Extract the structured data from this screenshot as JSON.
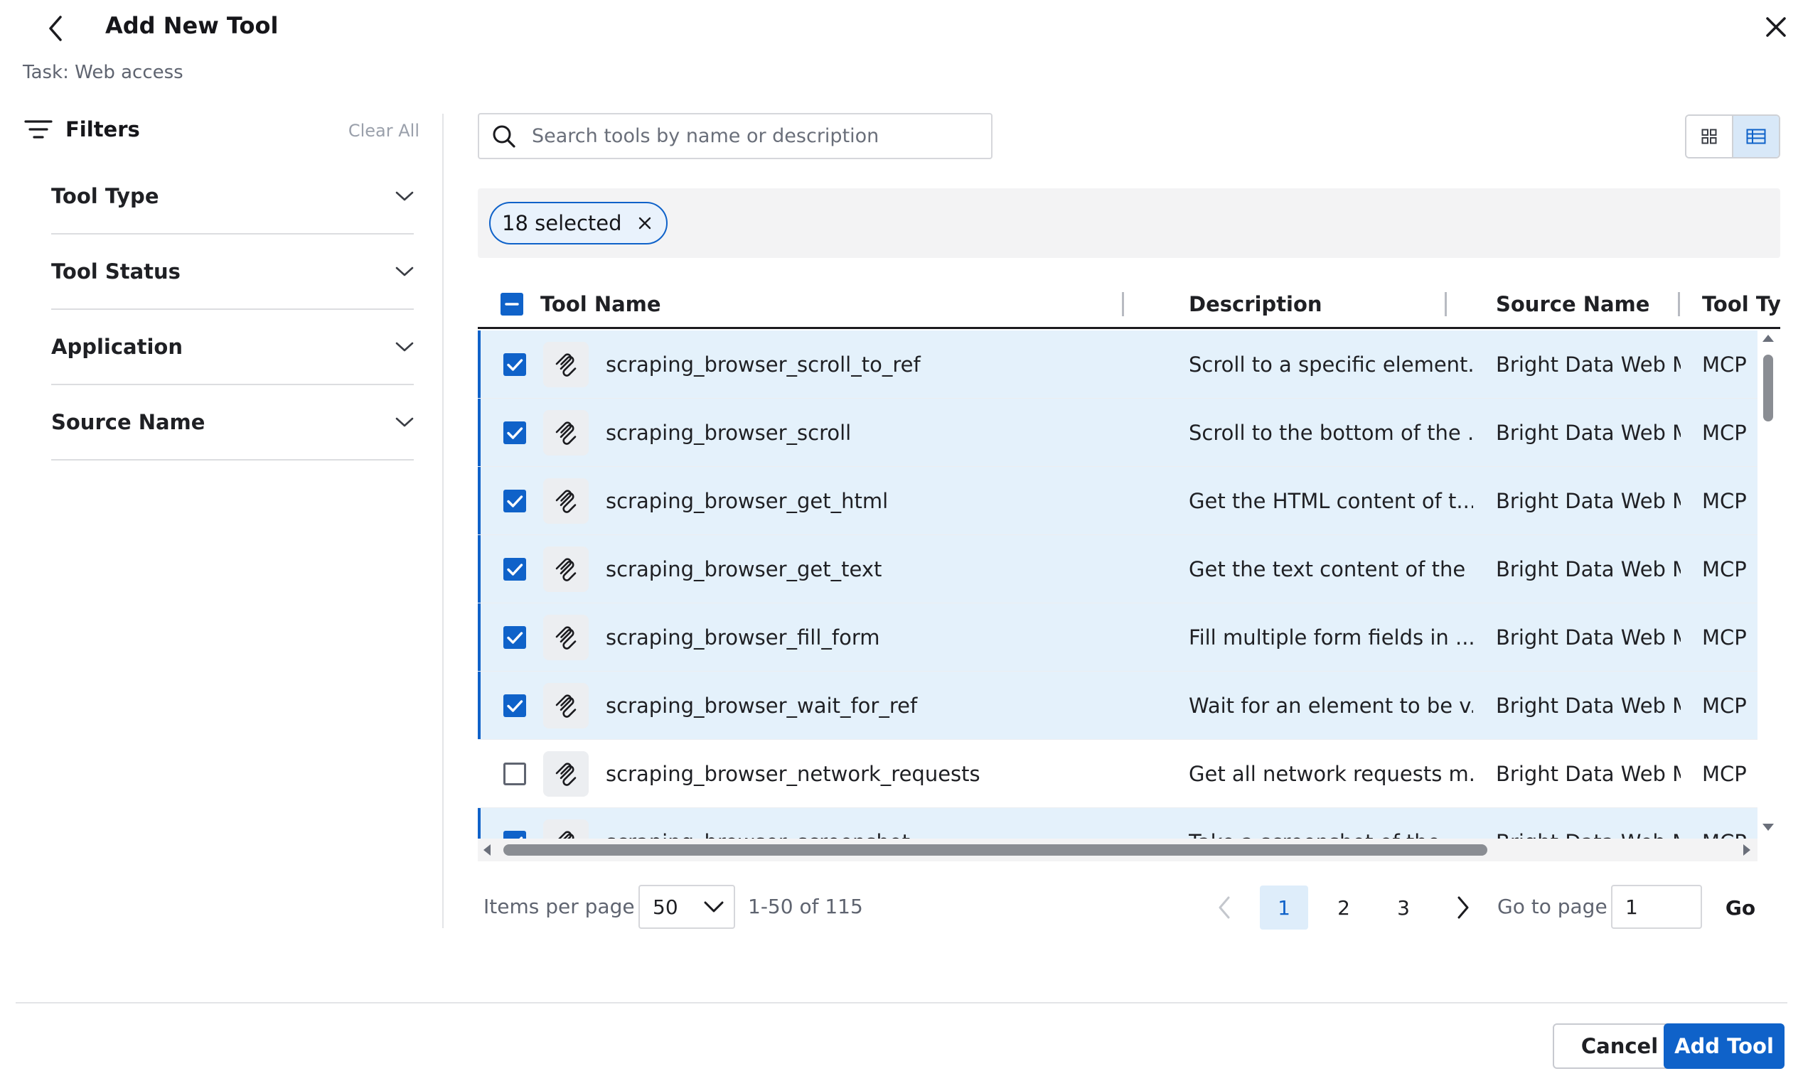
{
  "header": {
    "title": "Add New Tool",
    "subtitle": "Task: Web access"
  },
  "filters": {
    "title": "Filters",
    "clear_all": "Clear All",
    "sections": [
      "Tool Type",
      "Tool Status",
      "Application",
      "Source Name"
    ]
  },
  "search": {
    "placeholder": "Search tools by name or description"
  },
  "view_toggle": {
    "active": "list"
  },
  "selection": {
    "label": "18 selected"
  },
  "table": {
    "columns": [
      "Tool Name",
      "Description",
      "Source Name",
      "Tool Type"
    ],
    "header_checkbox": "indeterminate",
    "rows": [
      {
        "selected": true,
        "name": "scraping_browser_scroll_to_ref",
        "description": "Scroll to a specific element...",
        "source": "Bright Data Web M",
        "type": "MCP"
      },
      {
        "selected": true,
        "name": "scraping_browser_scroll",
        "description": "Scroll to the bottom of the ...",
        "source": "Bright Data Web M",
        "type": "MCP"
      },
      {
        "selected": true,
        "name": "scraping_browser_get_html",
        "description": "Get the HTML content of t...",
        "source": "Bright Data Web M",
        "type": "MCP"
      },
      {
        "selected": true,
        "name": "scraping_browser_get_text",
        "description": "Get the text content of the ...",
        "source": "Bright Data Web M",
        "type": "MCP"
      },
      {
        "selected": true,
        "name": "scraping_browser_fill_form",
        "description": "Fill multiple form fields in ...",
        "source": "Bright Data Web M",
        "type": "MCP"
      },
      {
        "selected": true,
        "name": "scraping_browser_wait_for_ref",
        "description": "Wait for an element to be v...",
        "source": "Bright Data Web M",
        "type": "MCP"
      },
      {
        "selected": false,
        "name": "scraping_browser_network_requests",
        "description": "Get all network requests m...",
        "source": "Bright Data Web M",
        "type": "MCP"
      },
      {
        "selected": true,
        "name": "scraping_browser_screenshot",
        "description": "Take a screenshot of the ...",
        "source": "Bright Data Web M",
        "type": "MCP"
      }
    ]
  },
  "pagination": {
    "items_per_page_label": "Items per page",
    "items_per_page": "50",
    "range": "1-50 of 115",
    "pages": [
      "1",
      "2",
      "3"
    ],
    "current_page": "1",
    "goto_label": "Go to page",
    "goto_value": "1",
    "go": "Go"
  },
  "footer": {
    "cancel": "Cancel",
    "add": "Add Tool"
  },
  "colors": {
    "primary": "#0f62c9",
    "row_selected": "#e4f1fb"
  }
}
